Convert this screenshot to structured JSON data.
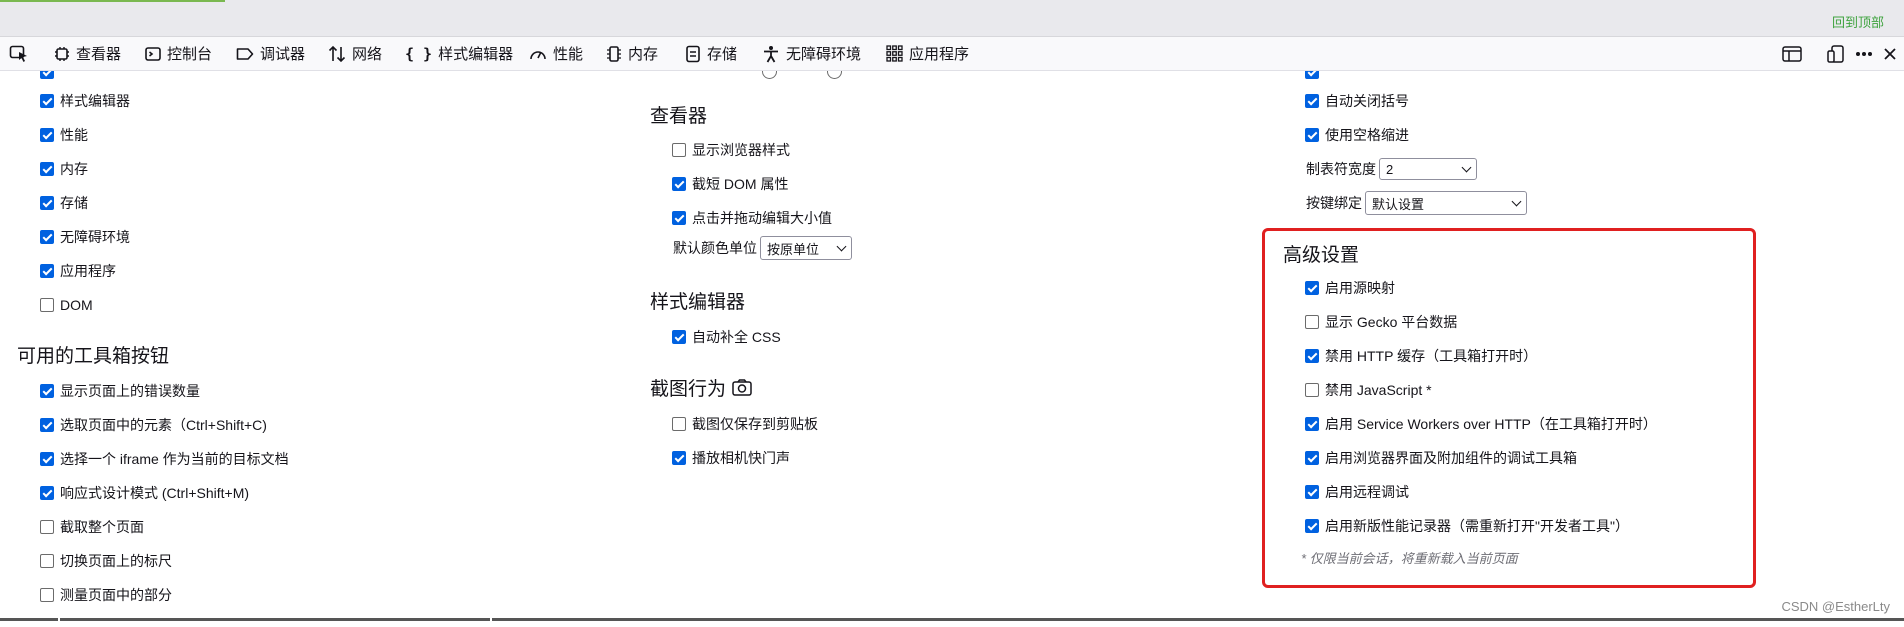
{
  "window": {
    "back_to_top": "回到顶部"
  },
  "toolbar": {
    "tabs": [
      {
        "label": "查看器",
        "icon": "inspector-icon"
      },
      {
        "label": "控制台",
        "icon": "console-icon"
      },
      {
        "label": "调试器",
        "icon": "debugger-icon"
      },
      {
        "label": "网络",
        "icon": "network-icon"
      },
      {
        "label": "样式编辑器",
        "icon": "style-editor-icon"
      },
      {
        "label": "性能",
        "icon": "performance-icon"
      },
      {
        "label": "内存",
        "icon": "memory-icon"
      },
      {
        "label": "存储",
        "icon": "storage-icon"
      },
      {
        "label": "无障碍环境",
        "icon": "accessibility-icon"
      },
      {
        "label": "应用程序",
        "icon": "application-icon"
      }
    ]
  },
  "left": {
    "tool_items": [
      {
        "label": "样式编辑器",
        "checked": true
      },
      {
        "label": "性能",
        "checked": true
      },
      {
        "label": "内存",
        "checked": true
      },
      {
        "label": "存储",
        "checked": true
      },
      {
        "label": "无障碍环境",
        "checked": true
      },
      {
        "label": "应用程序",
        "checked": true
      },
      {
        "label": "DOM",
        "checked": false
      }
    ],
    "buttons_heading": "可用的工具箱按钮",
    "button_items": [
      {
        "label": "显示页面上的错误数量",
        "checked": true
      },
      {
        "label": "选取页面中的元素（Ctrl+Shift+C)",
        "checked": true
      },
      {
        "label": "选择一个 iframe 作为当前的目标文档",
        "checked": true
      },
      {
        "label": "响应式设计模式 (Ctrl+Shift+M)",
        "checked": true
      },
      {
        "label": "截取整个页面",
        "checked": false
      },
      {
        "label": "切换页面上的标尺",
        "checked": false
      },
      {
        "label": "测量页面中的部分",
        "checked": false
      }
    ]
  },
  "middle": {
    "inspector_heading": "查看器",
    "inspector_items": [
      {
        "label": "显示浏览器样式",
        "checked": false
      },
      {
        "label": "截短 DOM 属性",
        "checked": true
      },
      {
        "label": "点击并拖动编辑大小值",
        "checked": true
      }
    ],
    "color_unit_label": "默认颜色单位",
    "color_unit_value": "按原单位",
    "style_heading": "样式编辑器",
    "style_items": [
      {
        "label": "自动补全 CSS",
        "checked": true
      }
    ],
    "screenshot_heading": "截图行为",
    "screenshot_items": [
      {
        "label": "截图仅保存到剪贴板",
        "checked": false
      },
      {
        "label": "播放相机快门声",
        "checked": true
      }
    ]
  },
  "right": {
    "editor_items": [
      {
        "label": "自动关闭括号",
        "checked": true
      },
      {
        "label": "使用空格缩进",
        "checked": true
      }
    ],
    "tab_width_label": "制表符宽度",
    "tab_width_value": "2",
    "keybinding_label": "按键绑定",
    "keybinding_value": "默认设置",
    "advanced_heading": "高级设置",
    "advanced_items": [
      {
        "label": "启用源映射",
        "checked": true
      },
      {
        "label": "显示 Gecko 平台数据",
        "checked": false
      },
      {
        "label": "禁用 HTTP 缓存（工具箱打开时）",
        "checked": true
      },
      {
        "label": "禁用 JavaScript *",
        "checked": false
      },
      {
        "label": "启用 Service Workers over HTTP（在工具箱打开时）",
        "checked": true
      },
      {
        "label": "启用浏览器界面及附加组件的调试工具箱",
        "checked": true
      },
      {
        "label": "启用远程调试",
        "checked": true
      },
      {
        "label": "启用新版性能记录器（需重新打开\"开发者工具\"）",
        "checked": true
      }
    ],
    "advanced_note": "* 仅限当前会话，将重新载入当前页面"
  },
  "watermark": "CSDN @EstherLty",
  "colors": {
    "accent": "#0061e0",
    "highlight_box": "#e02020",
    "back_to_top": "#3fa33f"
  }
}
